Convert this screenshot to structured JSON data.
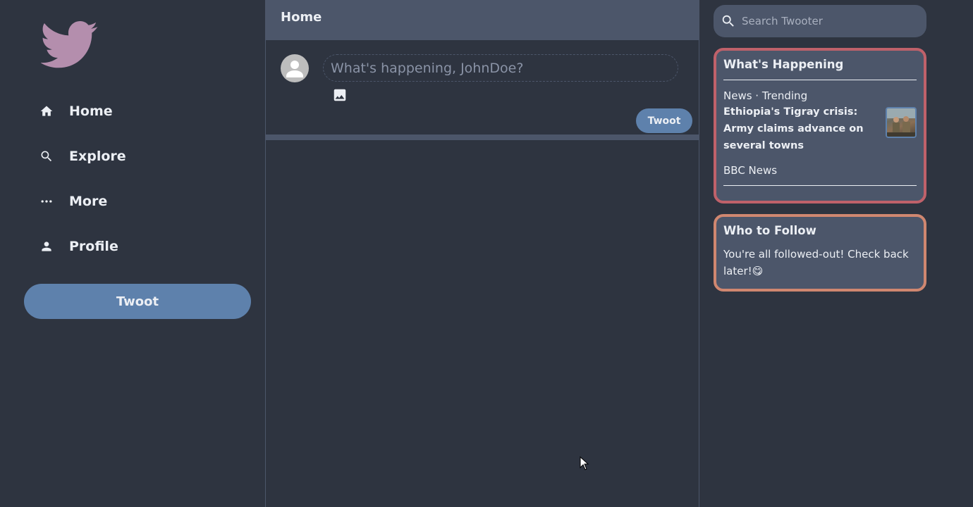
{
  "sidebar": {
    "logo": "twooter-bird-logo",
    "items": [
      {
        "label": "Home",
        "icon": "home-icon"
      },
      {
        "label": "Explore",
        "icon": "search-icon"
      },
      {
        "label": "More",
        "icon": "more-icon"
      },
      {
        "label": "Profile",
        "icon": "person-icon"
      }
    ],
    "twoot_button": "Twoot"
  },
  "main": {
    "title": "Home",
    "composer": {
      "placeholder": "What's happening, JohnDoe?",
      "image_icon": "image-icon",
      "twoot_button": "Twoot"
    }
  },
  "right": {
    "search": {
      "placeholder": "Search Twooter",
      "icon": "search-icon"
    },
    "happening": {
      "title": "What's Happening",
      "meta": "News · Trending",
      "headline": "Ethiopia's Tigray crisis: Army claims advance on several towns",
      "source": "BBC News"
    },
    "follow": {
      "title": "Who to Follow",
      "text": "You're all followed-out! Check back later!😋"
    }
  },
  "colors": {
    "background": "#2e3440",
    "panel": "#4c566a",
    "accent": "#5e81ac",
    "logo": "#b48ead",
    "happening_border": "#bf616a",
    "follow_border": "#d08770",
    "text": "#eceff4"
  }
}
